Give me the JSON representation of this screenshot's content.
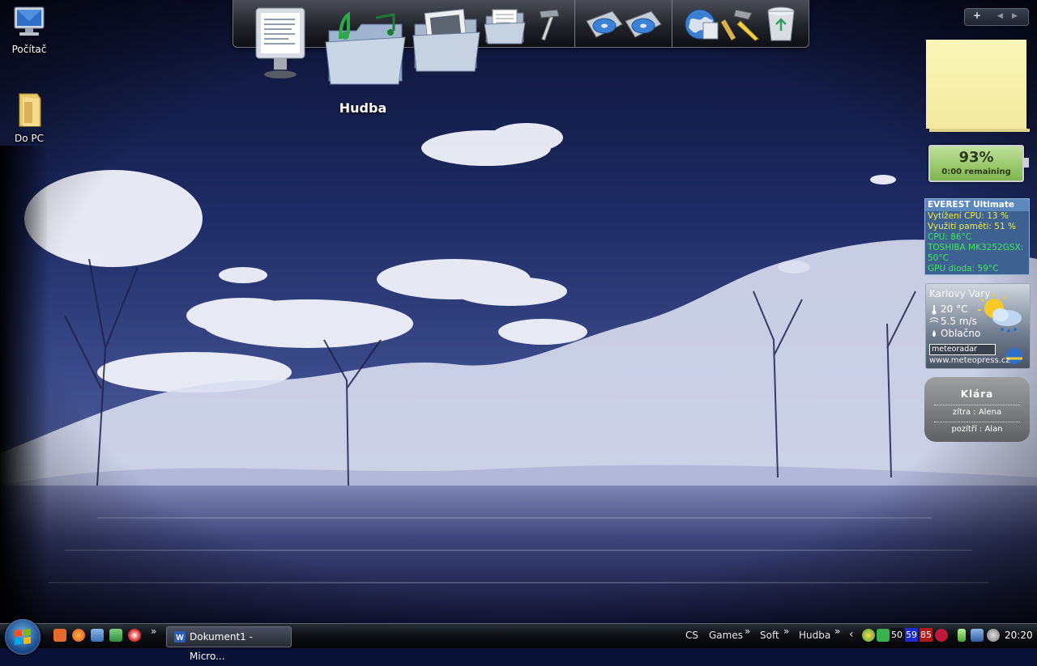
{
  "desktop": {
    "icons": [
      {
        "label": "Počítač"
      },
      {
        "label": "Do PC"
      }
    ]
  },
  "dock": {
    "hover_label": "Hudba",
    "items": [
      "document-viewer-icon",
      "music-folder-icon",
      "photos-folder-icon",
      "documents-folder-icon",
      "tools-hammer-icon",
      "dvd-drive-icon",
      "cd-drive-icon",
      "internet-globe-icon",
      "system-tools-icon",
      "recycle-bin-icon"
    ]
  },
  "sidebar_toolbar": {
    "add_label": "+",
    "prev_label": "◀",
    "next_label": "▶"
  },
  "battery": {
    "percent": "93%",
    "remaining": "0:00 remaining",
    "level": 0.93
  },
  "everest": {
    "title": "EVEREST Ultimate",
    "rows": [
      {
        "text": "Vytížení CPU: 13 %"
      },
      {
        "text": "Využití paměti: 51 %"
      },
      {
        "text": "CPU: 86°C"
      },
      {
        "text": "TOSHIBA MK3252GSX: 50°C"
      },
      {
        "text": "GPU dioda: 59°C"
      }
    ]
  },
  "weather": {
    "city": "Karlovy Vary",
    "temperature": "20 °C",
    "wind": "5.5 m/s",
    "condition": "Oblačno",
    "radar_label": "meteoradar",
    "site": "www.meteopress.cz"
  },
  "namedays": {
    "today": "Klára",
    "tomorrow": "zítra : Alena",
    "after_tomorrow": "pozítří : Alan"
  },
  "taskbar": {
    "task_button": "Dokument1 - Micro...",
    "quicklaunch_more": "»",
    "language": "CS",
    "toolbars": [
      "Games",
      "Soft",
      "Hudba"
    ],
    "tray_numbers": [
      "50",
      "59",
      "85"
    ],
    "clock": "20:20"
  },
  "colors": {
    "everest_bg": "#3d6190",
    "everest_header": "#5d88bd",
    "everest_yellow": "#f3ee3a",
    "everest_green": "#3ee85a",
    "note_yellow": "#f8f1b0"
  }
}
